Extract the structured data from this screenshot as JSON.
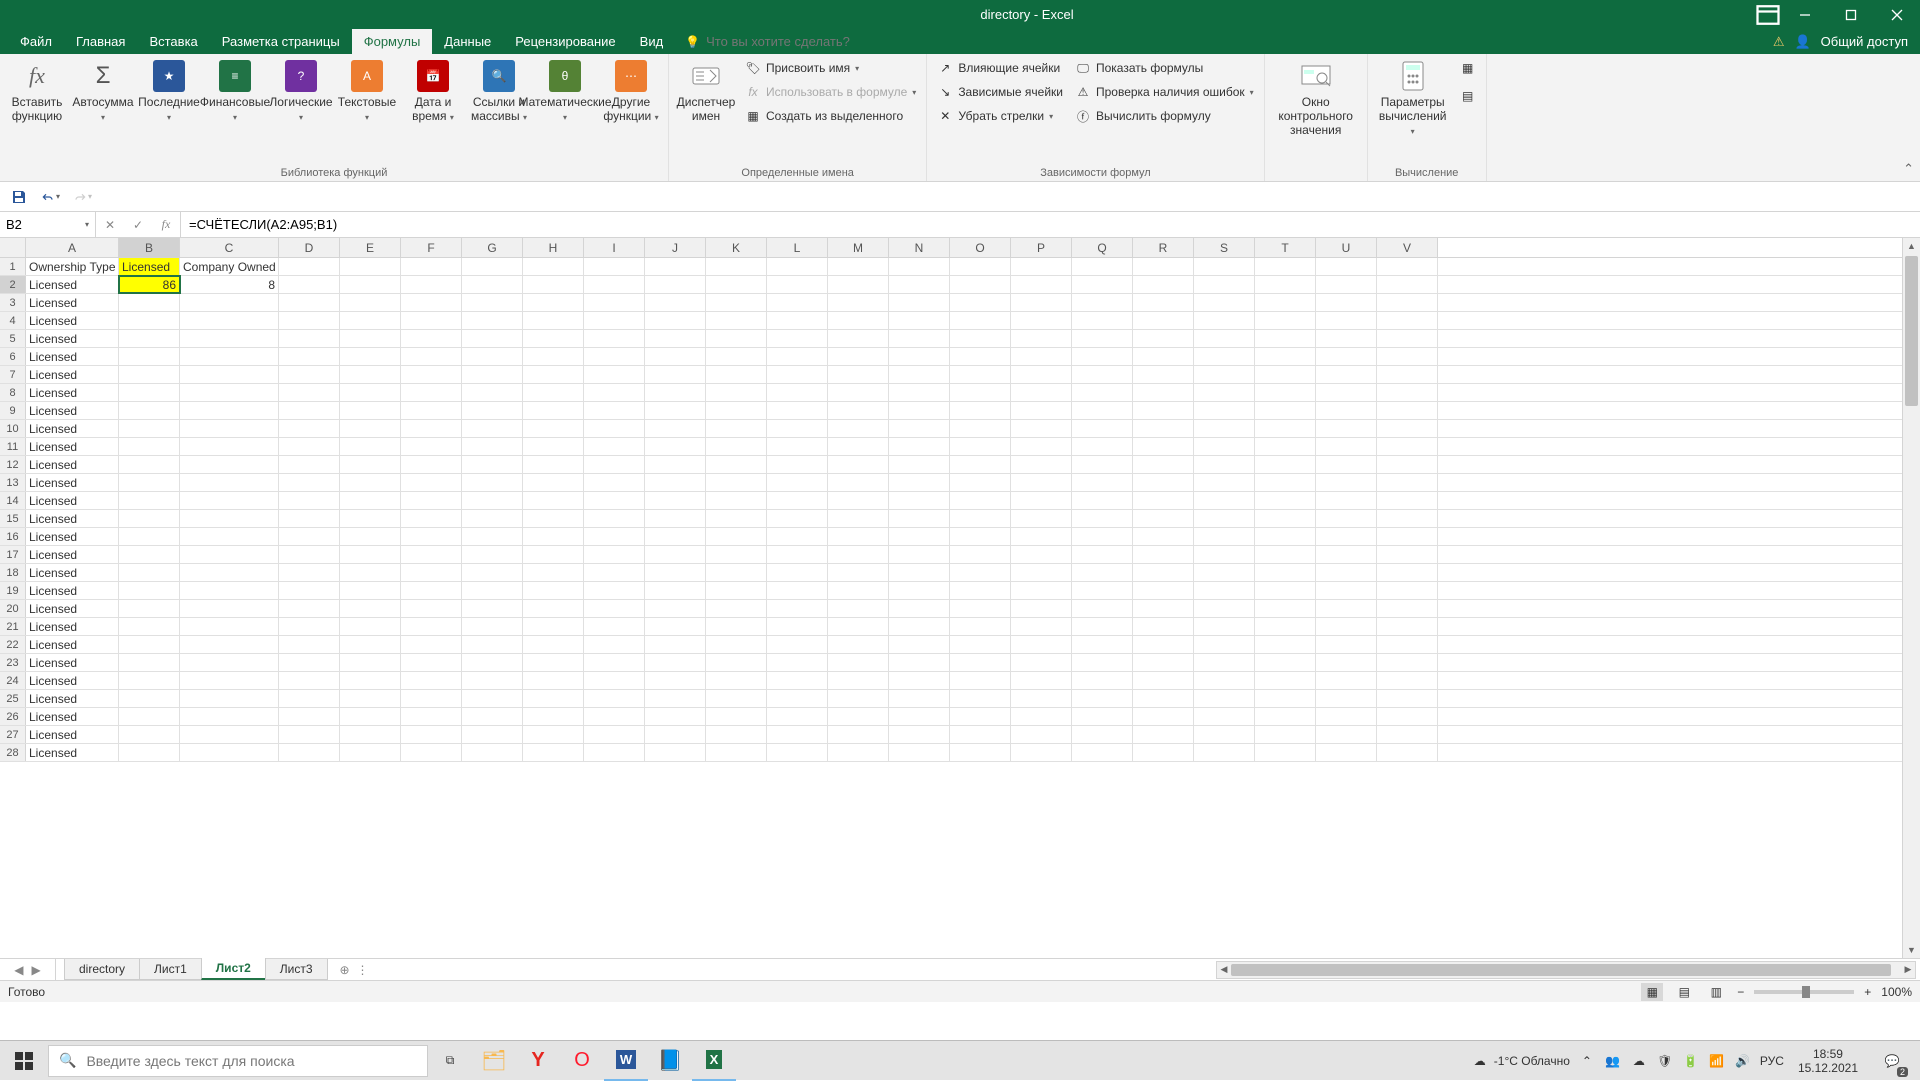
{
  "title": "directory - Excel",
  "tabs": {
    "file": "Файл",
    "home": "Главная",
    "insert": "Вставка",
    "page_layout": "Разметка страницы",
    "formulas": "Формулы",
    "data": "Данные",
    "review": "Рецензирование",
    "view": "Вид"
  },
  "tell_me_placeholder": "Что вы хотите сделать?",
  "share_label": "Общий доступ",
  "ribbon": {
    "insert_fn": "Вставить функцию",
    "autosum": "Автосумма",
    "recent": "Последние",
    "financial": "Финансовые",
    "logical": "Логические",
    "text": "Текстовые",
    "date_time": "Дата и время",
    "lookup": "Ссылки и массивы",
    "math": "Математические",
    "more": "Другие функции",
    "lib_label": "Библиотека функций",
    "name_mgr": "Диспетчер имен",
    "define_name": "Присвоить имя",
    "use_in_formula": "Использовать в формуле",
    "create_from_sel": "Создать из выделенного",
    "names_label": "Определенные имена",
    "trace_prec": "Влияющие ячейки",
    "trace_dep": "Зависимые ячейки",
    "remove_arrows": "Убрать стрелки",
    "show_formulas": "Показать формулы",
    "error_check": "Проверка наличия ошибок",
    "eval_formula": "Вычислить формулу",
    "audit_label": "Зависимости формул",
    "watch_window": "Окно контрольного значения",
    "calc_options": "Параметры вычислений",
    "calc_label": "Вычисление"
  },
  "name_box": "B2",
  "formula": "=СЧЁТЕСЛИ(A2:A95;B1)",
  "columns": [
    "A",
    "B",
    "C",
    "D",
    "E",
    "F",
    "G",
    "H",
    "I",
    "J",
    "K",
    "L",
    "M",
    "N",
    "O",
    "P",
    "Q",
    "R",
    "S",
    "T",
    "U",
    "V"
  ],
  "headers": {
    "A1": "Ownership Type",
    "B1": "Licensed",
    "C1": "Company Owned"
  },
  "values": {
    "B2": "86",
    "C2": "8"
  },
  "colA_fill": "Licensed",
  "visible_rows": 28,
  "sheets": [
    "directory",
    "Лист1",
    "Лист2",
    "Лист3"
  ],
  "active_sheet": "Лист2",
  "status": "Готово",
  "zoom": "100%",
  "taskbar": {
    "search_placeholder": "Введите здесь текст для поиска",
    "weather": "-1°C  Облачно",
    "lang": "РУС",
    "time": "18:59",
    "date": "15.12.2021",
    "notif_count": "2"
  }
}
